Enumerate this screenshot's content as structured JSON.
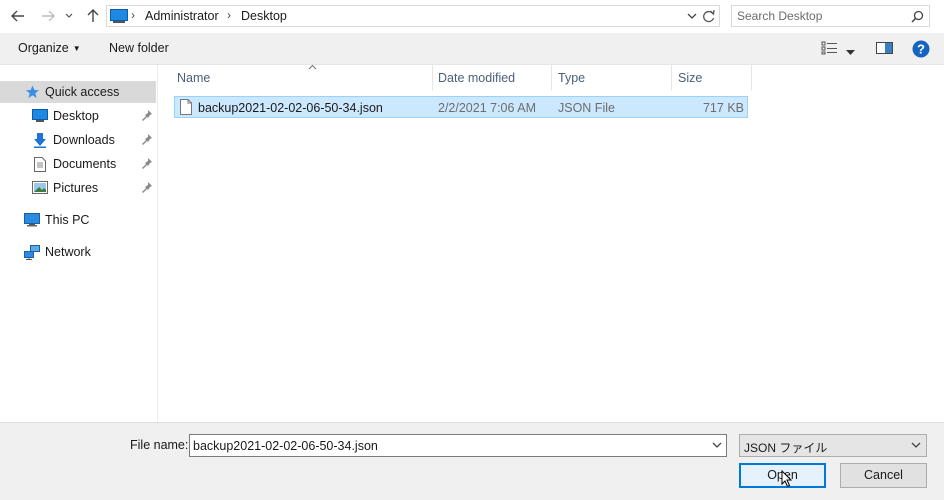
{
  "address_bar": {
    "crumbs": [
      "Administrator",
      "Desktop"
    ],
    "search_placeholder": "Search Desktop"
  },
  "command_bar": {
    "organize": "Organize",
    "organize_caret": "▼",
    "new_folder": "New folder"
  },
  "nav_pane": {
    "quick_access": "Quick access",
    "pinned": [
      {
        "label": "Desktop",
        "icon": "desktop-icon"
      },
      {
        "label": "Downloads",
        "icon": "downloads-icon"
      },
      {
        "label": "Documents",
        "icon": "documents-icon"
      },
      {
        "label": "Pictures",
        "icon": "pictures-icon"
      }
    ],
    "this_pc": "This PC",
    "network": "Network"
  },
  "file_list": {
    "columns": [
      "Name",
      "Date modified",
      "Type",
      "Size"
    ],
    "rows": [
      {
        "name": "backup2021-02-02-06-50-34.json",
        "date": "2/2/2021 7:06 AM",
        "type": "JSON File",
        "size": "717 KB",
        "selected": true
      }
    ]
  },
  "bottom": {
    "file_name_label": "File name:",
    "file_name_value": "backup2021-02-02-06-50-34.json",
    "file_type_value": "JSON ファイル",
    "open_label": "Open",
    "cancel_label": "Cancel"
  },
  "colors": {
    "selection_bg": "#cce8ff",
    "selection_border": "#99d1ff",
    "accent": "#0078d7",
    "header_text": "#4c607a"
  }
}
